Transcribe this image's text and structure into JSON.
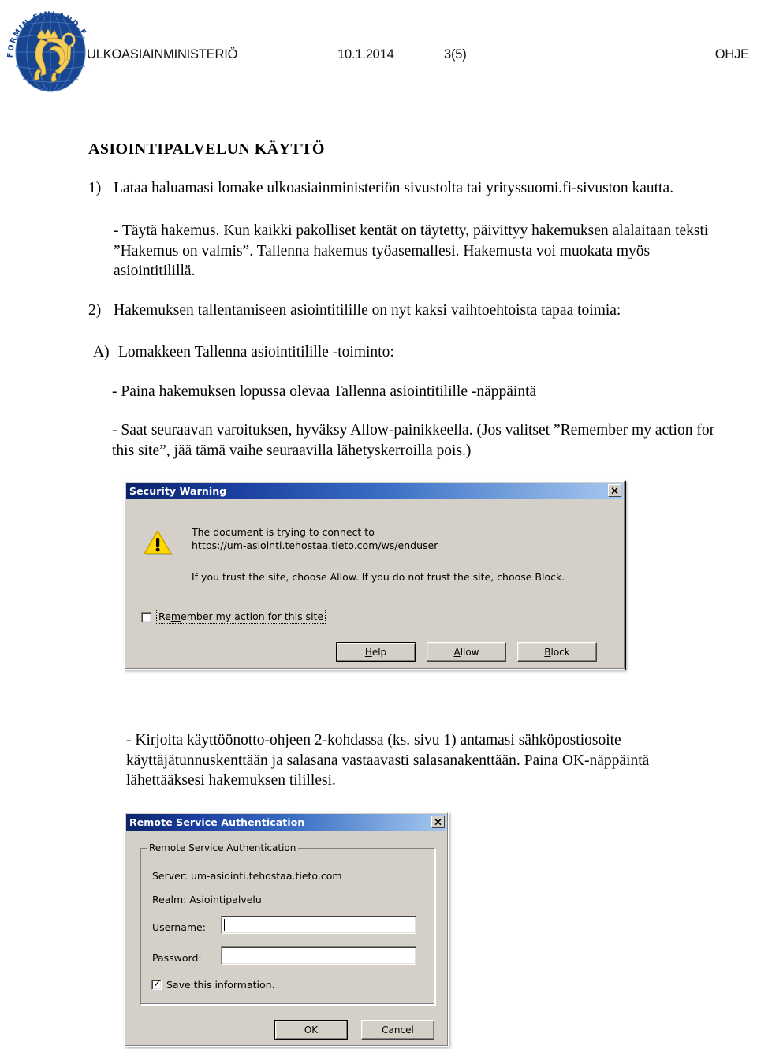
{
  "header": {
    "logo_text": "FORMIN.FINLAND.FI",
    "organization": "ULKOASIAINMINISTERIÖ",
    "date": "10.1.2014",
    "page_number": "3(5)",
    "doc_type": "OHJE"
  },
  "document": {
    "heading": "ASIOINTIPALVELUN  KÄYTTÖ",
    "item1_number": "1)",
    "item1_text": "Lataa haluamasi lomake ulkoasiainministeriön sivustolta tai yrityssuomi.fi-sivuston kautta.",
    "item1_sub": "- Täytä hakemus. Kun kaikki pakolliset kentät on täytetty, päivittyy hakemuksen alalaitaan teksti ”Hakemus on valmis”. Tallenna hakemus työasemallesi. Hakemusta voi muokata myös asiointitilillä.",
    "item2_number": "2)",
    "item2_text": "Hakemuksen tallentamiseen asiointitilille on nyt kaksi vaihtoehtoista tapaa toimia:",
    "itemA_number": "A)",
    "itemA_text": "Lomakkeen Tallenna asiointitilille -toiminto:",
    "itemA_bullet1": "- Paina hakemuksen lopussa olevaa Tallenna asiointitilille -näppäintä",
    "itemA_bullet2": "- Saat seuraavan varoituksen, hyväksy Allow-painikkeella. (Jos valitset ”Remember my action for this site”, jää tämä vaihe seuraavilla lähetyskerroilla pois.)",
    "bottom_text": "- Kirjoita käyttöönotto-ohjeen 2-kohdassa (ks. sivu 1) antamasi sähköpostiosoite käyttäjätunnuskenttään ja salasana vastaavasti salasanakenttään. Paina OK-näppäintä lähettääksesi hakemuksen tilillesi."
  },
  "security_dialog": {
    "title": "Security Warning",
    "close_label": "✕",
    "message_line1": "The document is trying to connect to",
    "message_line2": "https://um-asiointi.tehostaa.tieto.com/ws/enduser",
    "message_line3": "If you trust the site, choose Allow. If you do not trust the site, choose Block.",
    "checkbox_label_pre": "Re",
    "checkbox_label_acc": "m",
    "checkbox_label_post": "ember my action for this site",
    "checkbox_checked": false,
    "buttons": [
      {
        "pre": "",
        "acc": "H",
        "post": "elp",
        "default": true
      },
      {
        "pre": "",
        "acc": "A",
        "post": "llow",
        "default": false
      },
      {
        "pre": "",
        "acc": "B",
        "post": "lock",
        "default": false
      }
    ]
  },
  "auth_dialog": {
    "title": "Remote Service Authentication",
    "close_label": "✕",
    "group_label": "Remote Service Authentication",
    "server_line": "Server: um-asiointi.tehostaa.tieto.com",
    "realm_line": "Realm: Asiointipalvelu",
    "username_label": "Username:",
    "username_value": "",
    "password_label": "Password:",
    "password_value": "",
    "save_label": "Save this information.",
    "save_checked": true,
    "ok_label": "OK",
    "cancel_label": "Cancel"
  },
  "colors": {
    "titlebar_dark": "#0a246a",
    "titlebar_light": "#a6c8f0",
    "dialog_face": "#d4d0c8",
    "logo_blue": "#17458f",
    "logo_gold": "#f5cd5a",
    "warning_yellow": "#ffd700"
  }
}
